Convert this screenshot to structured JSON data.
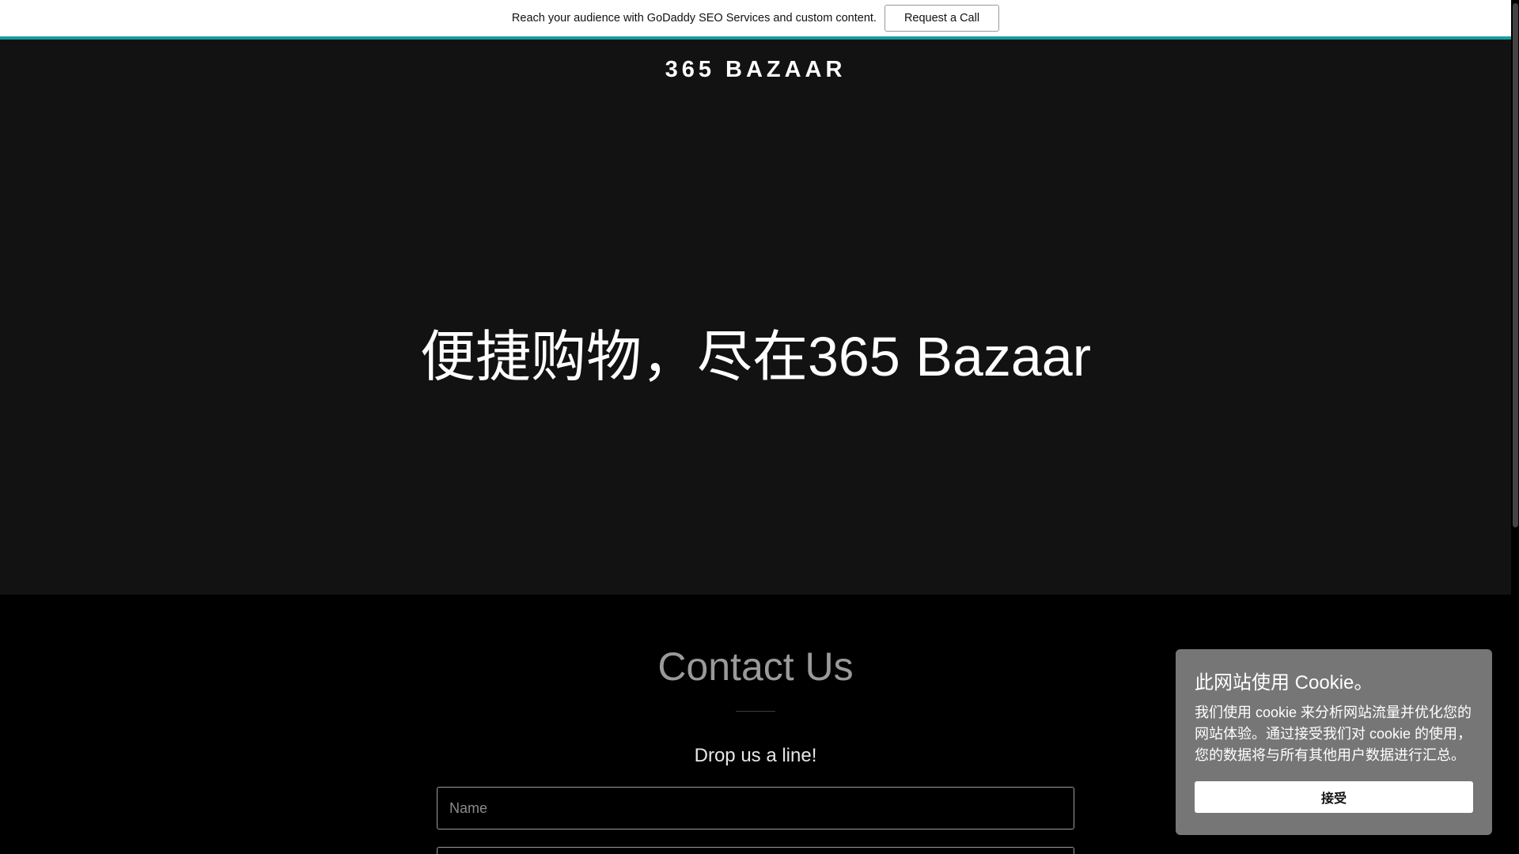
{
  "promo": {
    "text": "Reach your audience with GoDaddy SEO Services and custom content.",
    "button_label": "Request a Call"
  },
  "header": {
    "logo": "365 BAZAAR"
  },
  "hero": {
    "title": "便捷购物，尽在365 Bazaar"
  },
  "contact": {
    "title": "Contact Us",
    "subtitle": "Drop us a line!",
    "name_placeholder": "Name"
  },
  "cookie": {
    "title": "此网站使用 Cookie。",
    "body": "我们使用 cookie 来分析网站流量并优化您的网站体验。通过接受我们对 cookie 的使用，您的数据将与所有其他用户数据进行汇总。",
    "accept_label": "接受"
  },
  "colors": {
    "accent": "#1a9da3",
    "hero_background": "#121212",
    "cookie_background": "#767676"
  }
}
